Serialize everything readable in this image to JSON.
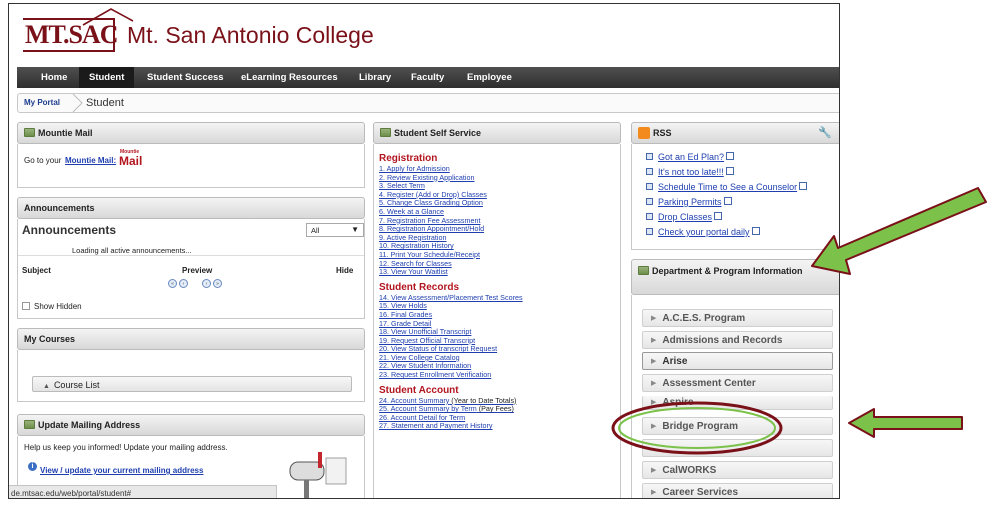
{
  "header": {
    "logo_text": "MT.SAC",
    "college_name": "Mt. San Antonio College"
  },
  "nav": {
    "items": [
      "Home",
      "Student",
      "Student Success",
      "eLearning Resources",
      "Library",
      "Faculty",
      "Employee"
    ],
    "active": "Student"
  },
  "breadcrumb": {
    "home": "My Portal",
    "current": "Student"
  },
  "mountie_mail": {
    "title": "Mountie Mail",
    "text": "Go to your",
    "link": "Mountie Mail:",
    "logo_top": "Mountie",
    "logo_bottom": "Mail"
  },
  "announcements": {
    "title": "Announcements",
    "heading": "Announcements",
    "filter_value": "All",
    "loading": "Loading all active announcements...",
    "col_subject": "Subject",
    "col_preview": "Preview",
    "col_hide": "Hide",
    "show_hidden": "Show Hidden"
  },
  "my_courses": {
    "title": "My Courses",
    "course_list": "Course List"
  },
  "update_address": {
    "title": "Update Mailing Address",
    "text": "Help us keep you informed! Update your mailing address.",
    "link": "View / update your current mailing address"
  },
  "status_url": "de.mtsac.edu/web/portal/student#",
  "self_service": {
    "title": "Student Self Service",
    "sections": [
      {
        "heading": "Registration",
        "items": [
          "1. Apply for Admission",
          "2. Review Existing Application",
          "3. Select Term",
          "4. Register (Add or Drop) Classes",
          "5. Change Class Grading Option",
          "6. Week at a Glance",
          "7. Registration Fee Assessment",
          "8. Registration Appointment/Hold",
          "9. Active Registration",
          "10. Registration History",
          "11. Print Your Schedule/Receipt",
          "12. Search for Classes",
          "13. View Your Waitlist"
        ]
      },
      {
        "heading": "Student Records",
        "items": [
          "14. View Assessment/Placement Test Scores",
          "15. View Holds",
          "16. Final Grades",
          "17. Grade Detail",
          "18. View Unofficial Transcript",
          "19. Request Official Transcript",
          "20. View Status of transcript Request",
          "21. View College Catalog",
          "22. View Student Information",
          "23. Request Enrollment Verification"
        ]
      },
      {
        "heading": "Student Account",
        "items": [
          {
            "link": "24. Account Summary",
            "plain": " (Year to Date Totals)"
          },
          {
            "link": "25. Account Summary by Term",
            "plain": " (Pay Fees)"
          },
          {
            "link": "26. Account Detail for Term",
            "plain": ""
          },
          {
            "link": "27. Statement and Payment History",
            "plain": ""
          }
        ]
      }
    ]
  },
  "rss": {
    "title": "RSS",
    "items": [
      "Got an Ed Plan?",
      "It's not too late!!!",
      "Schedule Time to See a Counselor",
      "Parking Permits",
      "Drop Classes",
      "Check your portal daily"
    ]
  },
  "department": {
    "title": "Department & Program Information",
    "items": [
      "A.C.E.S. Program",
      "Admissions and Records",
      "Arise",
      "Assessment Center",
      "Aspire",
      "Bridge Program",
      "",
      "CalWORKS",
      "Career Services"
    ]
  },
  "colors": {
    "brand": "#7a1018",
    "link": "#1f3fb0",
    "heading_red": "#b3151f",
    "arrow_green": "#7cc24a",
    "highlight_oval": "#7a1018"
  }
}
